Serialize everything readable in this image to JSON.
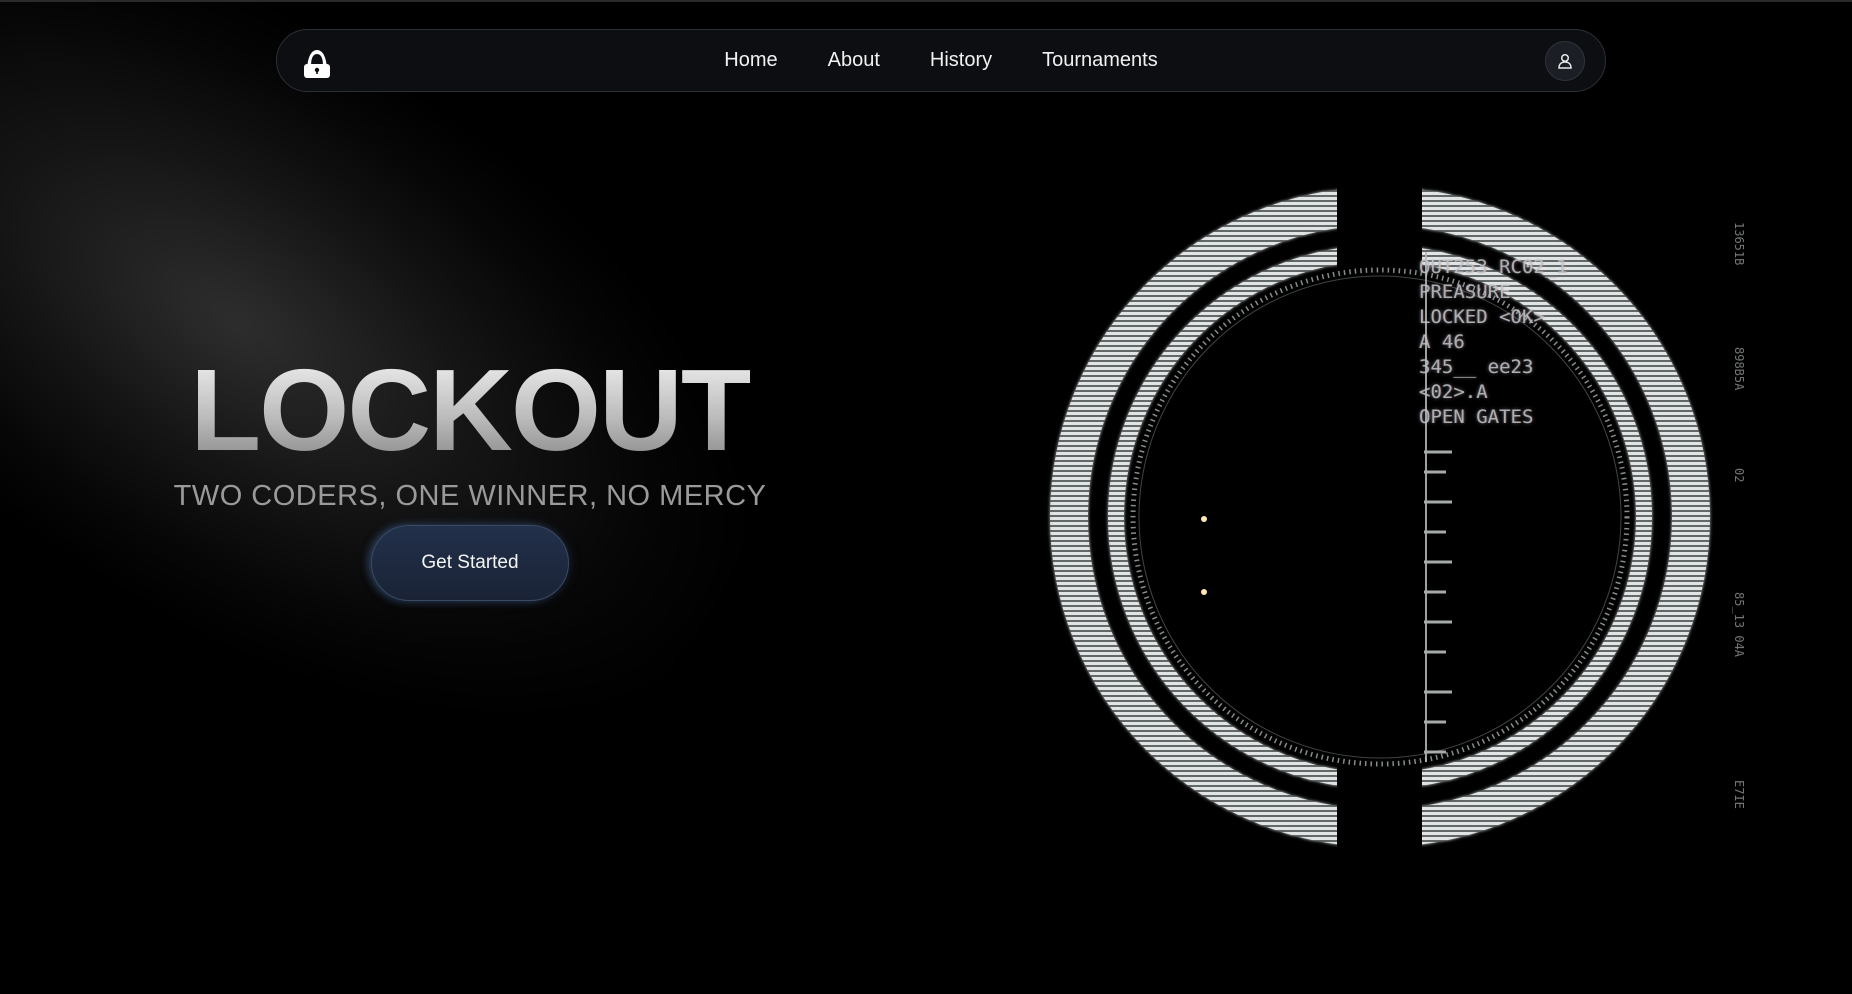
{
  "navbar": {
    "logo_icon": "hooded-hacker-lock-icon",
    "links": [
      {
        "label": "Home"
      },
      {
        "label": "About"
      },
      {
        "label": "History"
      },
      {
        "label": "Tournaments"
      }
    ],
    "user_icon": "user-icon"
  },
  "hero": {
    "title": "LOCKOUT",
    "subtitle": "TWO CODERS, ONE WINNER, NO MERCY",
    "cta_label": "Get Started"
  },
  "hud": {
    "terminal_lines": [
      "OUT253 RC02_1",
      "PREASURE",
      "LOCKED <OK>",
      "A 46",
      "345__ ee23",
      "<02>.A",
      "OPEN GATES"
    ],
    "side_labels": [
      "13651B",
      "898B5A",
      "02",
      "85_13 04A",
      "E7IE"
    ]
  },
  "colors": {
    "background": "#000000",
    "button": "#1f2b40",
    "hud_ring": "#d9dcdc"
  }
}
